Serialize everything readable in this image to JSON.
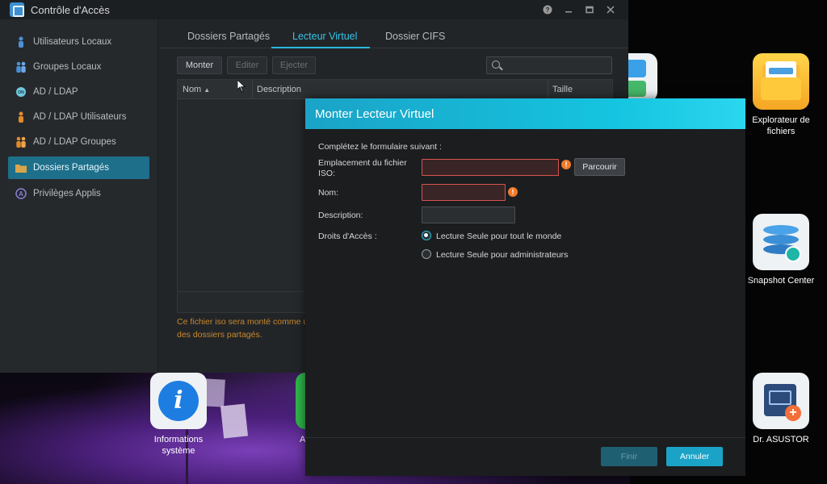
{
  "window": {
    "title": "Contrôle d'Accès",
    "controls": [
      "help-icon",
      "minimize-icon",
      "maximize-icon",
      "close-icon"
    ]
  },
  "sidebar": {
    "items": [
      {
        "label": "Utilisateurs Locaux",
        "icon": "user-icon",
        "active": false
      },
      {
        "label": "Groupes Locaux",
        "icon": "group-icon",
        "active": false
      },
      {
        "label": "AD / LDAP",
        "icon": "ldap-icon",
        "active": false
      },
      {
        "label": "AD / LDAP Utilisateurs",
        "icon": "ldap-user-icon",
        "active": false
      },
      {
        "label": "AD / LDAP Groupes",
        "icon": "ldap-group-icon",
        "active": false
      },
      {
        "label": "Dossiers Partagés",
        "icon": "folder-icon",
        "active": true
      },
      {
        "label": "Privilèges Applis",
        "icon": "app-privileges-icon",
        "active": false
      }
    ]
  },
  "tabs": [
    {
      "label": "Dossiers Partagés",
      "active": false
    },
    {
      "label": "Lecteur Virtuel",
      "active": true
    },
    {
      "label": "Dossier CIFS",
      "active": false
    }
  ],
  "toolbar": {
    "mount": "Monter",
    "edit": "Editer",
    "eject": "Ejecter"
  },
  "grid": {
    "columns": [
      "Nom",
      "Description",
      "Taille"
    ]
  },
  "note": "Ce fichier iso sera monté comme un des dossiers partagés.",
  "note_line1": "Ce fichier iso sera monté comme u",
  "note_line2": "des dossiers partagés.",
  "modal": {
    "title": "Monter Lecteur Virtuel",
    "intro": "Complétez le formulaire suivant :",
    "iso_label_1": "Emplacement du fichier",
    "iso_label_2": "ISO:",
    "iso_value": "",
    "browse": "Parcourir",
    "name_label": "Nom:",
    "name_value": "",
    "desc_label": "Description:",
    "desc_value": "",
    "rights_label": "Droits d'Accès :",
    "radio_all": "Lecture Seule pour tout le monde",
    "radio_admin": "Lecture Seule pour administrateurs",
    "selected_right": "all",
    "finish": "Finir",
    "cancel": "Annuler"
  },
  "desktop": {
    "icons": [
      {
        "label_1": "Explorateur de",
        "label_2": "fichiers",
        "icon": "file-explorer-icon"
      },
      {
        "label_1": "Snapshot Center",
        "label_2": "",
        "icon": "snapshot-center-icon"
      },
      {
        "label_1": "Dr. ASUSTOR",
        "label_2": "",
        "icon": "dr-asustor-icon"
      },
      {
        "label_1": "Informations",
        "label_2": "système",
        "icon": "system-info-icon"
      },
      {
        "label_1": "A",
        "label_2": "",
        "icon": "partial-app-icon"
      }
    ]
  },
  "colors": {
    "accent": "#1aa3c7",
    "sidebar_active": "#1d6f8a",
    "error_border": "#d9534f",
    "warning": "#f07a2a",
    "note": "#c8872b"
  }
}
